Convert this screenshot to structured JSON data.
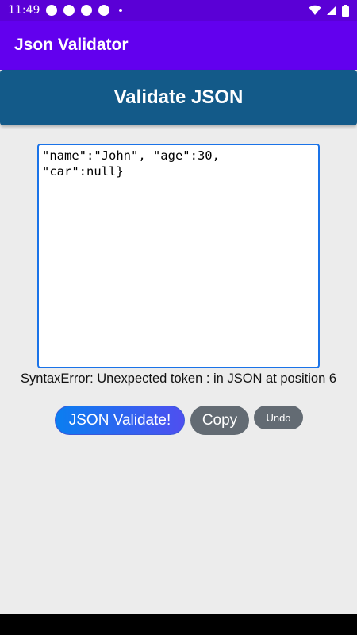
{
  "status_bar": {
    "time": "11:49"
  },
  "app_bar": {
    "title": "Json Validator"
  },
  "header": {
    "title": "Validate JSON"
  },
  "editor": {
    "value": "\"name\":\"John\", \"age\":30,\n\"car\":null}"
  },
  "error": {
    "message": "SyntaxError: Unexpected token : in JSON at position 6"
  },
  "buttons": {
    "validate_label": "JSON Validate!",
    "copy_label": "Copy",
    "undo_label": "Undo"
  },
  "colors": {
    "status_bar": "#5a00d6",
    "app_bar": "#6200ee",
    "header_banner": "#135a89",
    "background": "#ececec",
    "button_gray": "#636b73",
    "textarea_border": "#1a73e8"
  }
}
